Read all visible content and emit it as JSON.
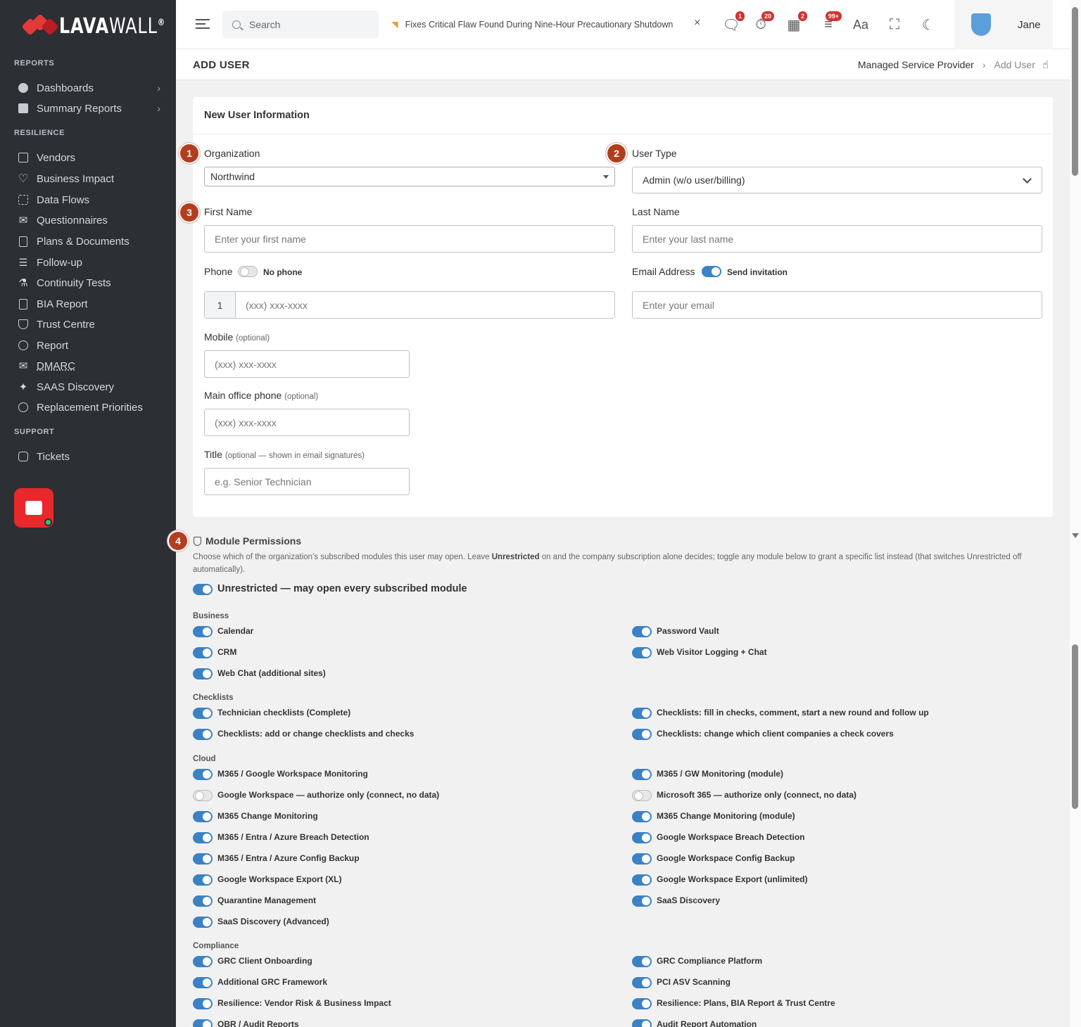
{
  "brand": {
    "name_bold": "LAVA",
    "name_thin": "WALL",
    "reg": "®",
    "accent": "#e23a3a"
  },
  "sidebar": {
    "sections": [
      {
        "title": "REPORTS",
        "items": [
          {
            "label": "Dashboards",
            "icon": "gauge-icon",
            "chevron": "›"
          },
          {
            "label": "Summary Reports",
            "icon": "report-doc-icon",
            "chevron": "›"
          }
        ]
      },
      {
        "title": "RESILIENCE",
        "items": [
          {
            "label": "Vendors",
            "icon": "building-icon"
          },
          {
            "label": "Business Impact",
            "icon": "heart-pulse-icon"
          },
          {
            "label": "Data Flows",
            "icon": "flow-icon"
          },
          {
            "label": "Questionnaires",
            "icon": "envelope-icon"
          },
          {
            "label": "Plans & Documents",
            "icon": "document-icon"
          },
          {
            "label": "Follow-up",
            "icon": "list-check-icon"
          },
          {
            "label": "Continuity Tests",
            "icon": "flask-icon"
          },
          {
            "label": "BIA Report",
            "icon": "chart-doc-icon"
          },
          {
            "label": "Trust Centre",
            "icon": "shield-check-icon"
          },
          {
            "label": "Report",
            "icon": "magnify-report-icon"
          },
          {
            "label": "DMARC",
            "icon": "mail-check-icon"
          },
          {
            "label": "SAAS Discovery",
            "icon": "sparkle-icon"
          },
          {
            "label": "Replacement Priorities",
            "icon": "recycle-icon"
          }
        ]
      },
      {
        "title": "SUPPORT",
        "items": [
          {
            "label": "Tickets",
            "icon": "ticket-icon"
          }
        ]
      }
    ]
  },
  "topbar": {
    "search_placeholder": "Search",
    "ticker": "Fixes Critical Flaw Found During Nine-Hour Precautionary Shutdown",
    "ticker_close": "×",
    "badges": {
      "messages": "1",
      "alerts": "20",
      "qr": "2",
      "feeds": "99+"
    },
    "font_glyph": "Aa",
    "user": "Jane"
  },
  "page": {
    "title": "ADD USER",
    "breadcrumb": [
      "Managed Service Provider",
      "Add User"
    ],
    "breadcrumb_sep": "›"
  },
  "form": {
    "card_title": "New User Information",
    "steps": [
      "1",
      "2",
      "3",
      "4"
    ],
    "organization_label": "Organization",
    "organization_value": "Northwind",
    "user_type_label": "User Type",
    "user_type_value": "Admin (w/o user/billing)",
    "first_name_label": "First Name",
    "first_name_placeholder": "Enter your first name",
    "last_name_label": "Last Name",
    "last_name_placeholder": "Enter your last name",
    "phone_label": "Phone",
    "no_phone_label": "No phone",
    "phone_prefix": "1",
    "phone_placeholder": "(xxx) xxx-xxxx",
    "email_label": "Email Address",
    "send_invitation_label": "Send invitation",
    "email_placeholder": "Enter your email",
    "mobile_label": "Mobile",
    "mobile_optional": "(optional)",
    "mobile_placeholder": "(xxx) xxx-xxxx",
    "office_label": "Main office phone",
    "office_optional": "(optional)",
    "office_placeholder": "(xxx) xxx-xxxx",
    "title_label": "Title",
    "title_optional": "(optional — shown in email signatures)",
    "title_placeholder": "e.g. Senior Technician"
  },
  "permissions": {
    "title": "Module Permissions",
    "desc_1": "Choose which of the organization's subscribed modules this user may open. Leave ",
    "desc_bold": "Unrestricted",
    "desc_2": " on and the company subscription alone decides; toggle any module below to grant a specific list instead (that switches Unrestricted off automatically).",
    "unrestricted_label": "Unrestricted — may open every subscribed module",
    "groups": [
      {
        "name": "Business",
        "left": [
          {
            "label": "Calendar",
            "on": true
          },
          {
            "label": "CRM",
            "on": true
          },
          {
            "label": "Web Chat (additional sites)",
            "on": true
          }
        ],
        "right": [
          {
            "label": "Password Vault",
            "on": true
          },
          {
            "label": "Web Visitor Logging + Chat",
            "on": true
          }
        ]
      },
      {
        "name": "Checklists",
        "left": [
          {
            "label": "Technician checklists (Complete)",
            "on": true
          },
          {
            "label": "Checklists: add or change checklists and checks",
            "on": true
          }
        ],
        "right": [
          {
            "label": "Checklists: fill in checks, comment, start a new round and follow up",
            "on": true
          },
          {
            "label": "Checklists: change which client companies a check covers",
            "on": true
          }
        ]
      },
      {
        "name": "Cloud",
        "left": [
          {
            "label": "M365 / Google Workspace Monitoring",
            "on": true
          },
          {
            "label": "Google Workspace — authorize only (connect, no data)",
            "on": false
          },
          {
            "label": "M365 Change Monitoring",
            "on": true
          },
          {
            "label": "M365 / Entra / Azure Breach Detection",
            "on": true
          },
          {
            "label": "M365 / Entra / Azure Config Backup",
            "on": true
          },
          {
            "label": "Google Workspace Export (XL)",
            "on": true
          },
          {
            "label": "Quarantine Management",
            "on": true
          },
          {
            "label": "SaaS Discovery (Advanced)",
            "on": true
          }
        ],
        "right": [
          {
            "label": "M365 / GW Monitoring (module)",
            "on": true
          },
          {
            "label": "Microsoft 365 — authorize only (connect, no data)",
            "on": false
          },
          {
            "label": "M365 Change Monitoring (module)",
            "on": true
          },
          {
            "label": "Google Workspace Breach Detection",
            "on": true
          },
          {
            "label": "Google Workspace Config Backup",
            "on": true
          },
          {
            "label": "Google Workspace Export (unlimited)",
            "on": true
          },
          {
            "label": "SaaS Discovery",
            "on": true
          }
        ]
      },
      {
        "name": "Compliance",
        "left": [
          {
            "label": "GRC Client Onboarding",
            "on": true
          },
          {
            "label": "Additional GRC Framework",
            "on": true
          },
          {
            "label": "Resilience: Vendor Risk & Business Impact",
            "on": true
          },
          {
            "label": "QBR / Audit Reports",
            "on": true
          }
        ],
        "right": [
          {
            "label": "GRC Compliance Platform",
            "on": true
          },
          {
            "label": "PCI ASV Scanning",
            "on": true
          },
          {
            "label": "Resilience: Plans, BIA Report & Trust Centre",
            "on": true
          },
          {
            "label": "Audit Report Automation",
            "on": true
          }
        ]
      }
    ]
  },
  "colors": {
    "toggle_on": "#3b82c4",
    "step_badge": "#b23e1f",
    "sidebar_bg": "#2c2f34"
  }
}
